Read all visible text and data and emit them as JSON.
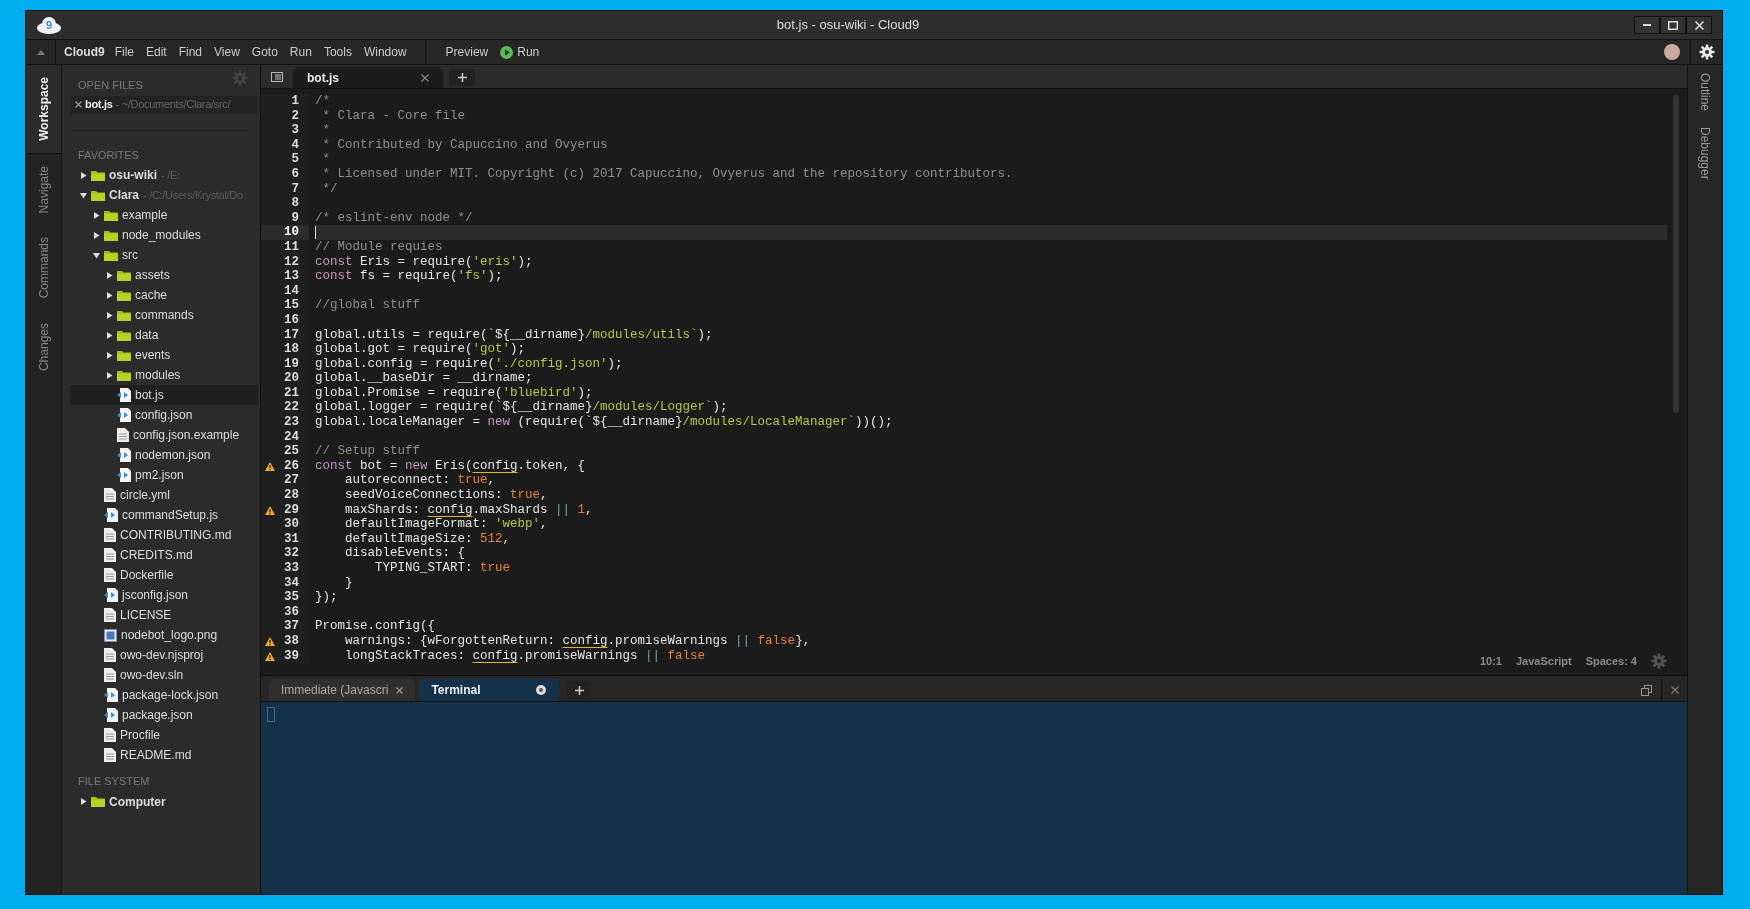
{
  "window": {
    "logo": "9",
    "title": "bot.js - osu-wiki - Cloud9"
  },
  "menu_bar": {
    "brand": "Cloud9",
    "items": [
      "File",
      "Edit",
      "Find",
      "View",
      "Goto",
      "Run",
      "Tools",
      "Window"
    ],
    "actions": [
      {
        "label": "Preview",
        "kind": "plain"
      },
      {
        "label": "Run",
        "kind": "run"
      }
    ]
  },
  "left_tabs": [
    {
      "label": "Workspace",
      "selected": true
    },
    {
      "label": "Navigate",
      "selected": false
    },
    {
      "label": "Commands",
      "selected": false
    },
    {
      "label": "Changes",
      "selected": false
    }
  ],
  "right_tabs": [
    {
      "label": "Outline",
      "selected": false
    },
    {
      "label": "Debugger",
      "selected": false
    }
  ],
  "sidebar": {
    "open_files_heading": "OPEN FILES",
    "open_files": [
      {
        "name": "bot.js",
        "path": "- ~/Documents/Clara/src/"
      }
    ],
    "favorites_heading": "FAVORITES",
    "favorites": [
      {
        "name": "osu-wiki",
        "path": "- /E:",
        "kind": "folder",
        "expanded": false,
        "selected": false
      },
      {
        "name": "Clara",
        "path": "- /C:/Users/Krystal/Do",
        "kind": "folder",
        "expanded": true,
        "selected": false,
        "children": [
          {
            "name": "example",
            "kind": "folder",
            "expanded": false,
            "selected": false
          },
          {
            "name": "node_modules",
            "kind": "folder",
            "expanded": false,
            "selected": false
          },
          {
            "name": "src",
            "kind": "folder",
            "expanded": true,
            "selected": false,
            "children": [
              {
                "name": "assets",
                "kind": "folder",
                "expanded": false,
                "selected": false
              },
              {
                "name": "cache",
                "kind": "folder",
                "expanded": false,
                "selected": false
              },
              {
                "name": "commands",
                "kind": "folder",
                "expanded": false,
                "selected": false
              },
              {
                "name": "data",
                "kind": "folder",
                "expanded": false,
                "selected": false
              },
              {
                "name": "events",
                "kind": "folder",
                "expanded": false,
                "selected": false
              },
              {
                "name": "modules",
                "kind": "folder",
                "expanded": false,
                "selected": false
              },
              {
                "name": "bot.js",
                "kind": "code",
                "selected": true
              },
              {
                "name": "config.json",
                "kind": "code",
                "selected": false
              },
              {
                "name": "config.json.example",
                "kind": "text",
                "selected": false
              },
              {
                "name": "nodemon.json",
                "kind": "code",
                "selected": false
              },
              {
                "name": "pm2.json",
                "kind": "code",
                "selected": false
              }
            ]
          },
          {
            "name": "circle.yml",
            "kind": "text",
            "selected": false
          },
          {
            "name": "commandSetup.js",
            "kind": "code",
            "selected": false
          },
          {
            "name": "CONTRIBUTING.md",
            "kind": "text",
            "selected": false
          },
          {
            "name": "CREDITS.md",
            "kind": "text",
            "selected": false
          },
          {
            "name": "Dockerfile",
            "kind": "text",
            "selected": false
          },
          {
            "name": "jsconfig.json",
            "kind": "code",
            "selected": false
          },
          {
            "name": "LICENSE",
            "kind": "text",
            "selected": false
          },
          {
            "name": "nodebot_logo.png",
            "kind": "image",
            "selected": false
          },
          {
            "name": "owo-dev.njsproj",
            "kind": "text",
            "selected": false
          },
          {
            "name": "owo-dev.sln",
            "kind": "text",
            "selected": false
          },
          {
            "name": "package-lock.json",
            "kind": "code",
            "selected": false
          },
          {
            "name": "package.json",
            "kind": "code",
            "selected": false
          },
          {
            "name": "Procfile",
            "kind": "text",
            "selected": false
          },
          {
            "name": "README.md",
            "kind": "text",
            "selected": false
          }
        ]
      }
    ],
    "file_system_heading": "FILE SYSTEM",
    "file_system": [
      {
        "name": "Computer",
        "kind": "folder",
        "expanded": false,
        "selected": false
      }
    ]
  },
  "editor": {
    "tabs": [
      {
        "label": "bot.js",
        "selected": true
      }
    ],
    "lines": [
      {
        "n": "1",
        "warning": false,
        "active": false,
        "tokens": [
          {
            "kind": "comment",
            "text": "/*"
          }
        ]
      },
      {
        "n": "2",
        "warning": false,
        "active": false,
        "tokens": [
          {
            "kind": "comment",
            "text": " * Clara - Core file"
          }
        ]
      },
      {
        "n": "3",
        "warning": false,
        "active": false,
        "tokens": [
          {
            "kind": "comment",
            "text": " *"
          }
        ]
      },
      {
        "n": "4",
        "warning": false,
        "active": false,
        "tokens": [
          {
            "kind": "comment",
            "text": " * Contributed by Capuccino and Ovyerus"
          }
        ]
      },
      {
        "n": "5",
        "warning": false,
        "active": false,
        "tokens": [
          {
            "kind": "comment",
            "text": " *"
          }
        ]
      },
      {
        "n": "6",
        "warning": false,
        "active": false,
        "tokens": [
          {
            "kind": "comment",
            "text": " * Licensed under MIT. Copyright (c) 2017 Capuccino, Ovyerus and the repository contributors."
          }
        ]
      },
      {
        "n": "7",
        "warning": false,
        "active": false,
        "tokens": [
          {
            "kind": "comment",
            "text": " */"
          }
        ]
      },
      {
        "n": "8",
        "warning": false,
        "active": false
      },
      {
        "n": "9",
        "warning": false,
        "active": false,
        "tokens": [
          {
            "kind": "comment",
            "text": "/* eslint-env node */"
          }
        ]
      },
      {
        "n": "10",
        "warning": false,
        "active": true
      },
      {
        "n": "11",
        "warning": false,
        "active": false,
        "tokens": [
          {
            "kind": "comment",
            "text": "// Module requies"
          }
        ]
      },
      {
        "n": "12",
        "warning": false,
        "active": false,
        "tokens": [
          {
            "kind": "keyword",
            "text": "const"
          },
          {
            "kind": "plain",
            "text": " Eris = require("
          },
          {
            "kind": "string",
            "text": "'eris'"
          },
          {
            "kind": "plain",
            "text": ");"
          }
        ]
      },
      {
        "n": "13",
        "warning": false,
        "active": false,
        "tokens": [
          {
            "kind": "keyword",
            "text": "const"
          },
          {
            "kind": "plain",
            "text": " fs = require("
          },
          {
            "kind": "string",
            "text": "'fs'"
          },
          {
            "kind": "plain",
            "text": ");"
          }
        ]
      },
      {
        "n": "14",
        "warning": false,
        "active": false
      },
      {
        "n": "15",
        "warning": false,
        "active": false,
        "tokens": [
          {
            "kind": "comment",
            "text": "//global stuff"
          }
        ]
      },
      {
        "n": "16",
        "warning": false,
        "active": false
      },
      {
        "n": "17",
        "warning": false,
        "active": false,
        "tokens": [
          {
            "kind": "plain",
            "text": "global.utils = require(`${__dirname}"
          },
          {
            "kind": "string",
            "text": "/modules/utils`"
          },
          {
            "kind": "plain",
            "text": ");"
          }
        ]
      },
      {
        "n": "18",
        "warning": false,
        "active": false,
        "tokens": [
          {
            "kind": "plain",
            "text": "global.got = require("
          },
          {
            "kind": "string",
            "text": "'got'"
          },
          {
            "kind": "plain",
            "text": ");"
          }
        ]
      },
      {
        "n": "19",
        "warning": false,
        "active": false,
        "tokens": [
          {
            "kind": "plain",
            "text": "global.config = require("
          },
          {
            "kind": "string",
            "text": "'./config.json'"
          },
          {
            "kind": "plain",
            "text": ");"
          }
        ]
      },
      {
        "n": "20",
        "warning": false,
        "active": false,
        "tokens": [
          {
            "kind": "plain",
            "text": "global.__baseDir = __dirname;"
          }
        ]
      },
      {
        "n": "21",
        "warning": false,
        "active": false,
        "tokens": [
          {
            "kind": "plain",
            "text": "global.Promise = require("
          },
          {
            "kind": "string",
            "text": "'bluebird'"
          },
          {
            "kind": "plain",
            "text": ");"
          }
        ]
      },
      {
        "n": "22",
        "warning": false,
        "active": false,
        "tokens": [
          {
            "kind": "plain",
            "text": "global.logger = require(`${__dirname}"
          },
          {
            "kind": "string",
            "text": "/modules/Logger`"
          },
          {
            "kind": "plain",
            "text": ");"
          }
        ]
      },
      {
        "n": "23",
        "warning": false,
        "active": false,
        "tokens": [
          {
            "kind": "plain",
            "text": "global.localeManager = "
          },
          {
            "kind": "keyword",
            "text": "new"
          },
          {
            "kind": "plain",
            "text": " (require(`${__dirname}"
          },
          {
            "kind": "string",
            "text": "/modules/LocaleManager`"
          },
          {
            "kind": "plain",
            "text": "))();"
          }
        ]
      },
      {
        "n": "24",
        "warning": false,
        "active": false
      },
      {
        "n": "25",
        "warning": false,
        "active": false,
        "tokens": [
          {
            "kind": "comment",
            "text": "// Setup stuff"
          }
        ]
      },
      {
        "n": "26",
        "warning": true,
        "active": false,
        "tokens": [
          {
            "kind": "keyword",
            "text": "const"
          },
          {
            "kind": "plain",
            "text": " bot = "
          },
          {
            "kind": "keyword",
            "text": "new"
          },
          {
            "kind": "plain",
            "text": " Eris("
          },
          {
            "kind": "flagged",
            "text": "config"
          },
          {
            "kind": "plain",
            "text": ".token, {"
          }
        ]
      },
      {
        "n": "27",
        "warning": false,
        "active": false,
        "tokens": [
          {
            "kind": "plain",
            "text": "    autoreconnect: "
          },
          {
            "kind": "literal",
            "text": "true"
          },
          {
            "kind": "plain",
            "text": ","
          }
        ]
      },
      {
        "n": "28",
        "warning": false,
        "active": false,
        "tokens": [
          {
            "kind": "plain",
            "text": "    seedVoiceConnections: "
          },
          {
            "kind": "literal",
            "text": "true"
          },
          {
            "kind": "plain",
            "text": ","
          }
        ]
      },
      {
        "n": "29",
        "warning": true,
        "active": false,
        "tokens": [
          {
            "kind": "plain",
            "text": "    maxShards: "
          },
          {
            "kind": "flagged",
            "text": "config"
          },
          {
            "kind": "plain",
            "text": ".maxShards "
          },
          {
            "kind": "operator",
            "text": "|| "
          },
          {
            "kind": "literal",
            "text": "1"
          },
          {
            "kind": "plain",
            "text": ","
          }
        ]
      },
      {
        "n": "30",
        "warning": false,
        "active": false,
        "tokens": [
          {
            "kind": "plain",
            "text": "    defaultImageFormat: "
          },
          {
            "kind": "string",
            "text": "'webp'"
          },
          {
            "kind": "plain",
            "text": ","
          }
        ]
      },
      {
        "n": "31",
        "warning": false,
        "active": false,
        "tokens": [
          {
            "kind": "plain",
            "text": "    defaultImageSize: "
          },
          {
            "kind": "literal",
            "text": "512"
          },
          {
            "kind": "plain",
            "text": ","
          }
        ]
      },
      {
        "n": "32",
        "warning": false,
        "active": false,
        "tokens": [
          {
            "kind": "plain",
            "text": "    disableEvents: {"
          }
        ]
      },
      {
        "n": "33",
        "warning": false,
        "active": false,
        "tokens": [
          {
            "kind": "plain",
            "text": "        TYPING_START: "
          },
          {
            "kind": "literal",
            "text": "true"
          }
        ]
      },
      {
        "n": "34",
        "warning": false,
        "active": false,
        "tokens": [
          {
            "kind": "plain",
            "text": "    }"
          }
        ]
      },
      {
        "n": "35",
        "warning": false,
        "active": false,
        "tokens": [
          {
            "kind": "plain",
            "text": "});"
          }
        ]
      },
      {
        "n": "36",
        "warning": false,
        "active": false
      },
      {
        "n": "37",
        "warning": false,
        "active": false,
        "tokens": [
          {
            "kind": "plain",
            "text": "Promise.config({"
          }
        ]
      },
      {
        "n": "38",
        "warning": true,
        "active": false,
        "tokens": [
          {
            "kind": "plain",
            "text": "    warnings: {wForgottenReturn: "
          },
          {
            "kind": "flagged",
            "text": "config"
          },
          {
            "kind": "plain",
            "text": ".promiseWarnings "
          },
          {
            "kind": "operator",
            "text": "|| "
          },
          {
            "kind": "literal",
            "text": "false"
          },
          {
            "kind": "plain",
            "text": "},"
          }
        ]
      },
      {
        "n": "39",
        "warning": true,
        "active": false,
        "tokens": [
          {
            "kind": "plain",
            "text": "    longStackTraces: "
          },
          {
            "kind": "flagged",
            "text": "config"
          },
          {
            "kind": "plain",
            "text": ".promiseWarnings "
          },
          {
            "kind": "operator",
            "text": "|| "
          },
          {
            "kind": "literal",
            "text": "false"
          }
        ]
      }
    ],
    "status": {
      "position": "10:1",
      "mode": "JavaScript",
      "indent": "Spaces: 4"
    }
  },
  "bottom_panel": {
    "tabs": [
      {
        "label": "Immediate (Javascri",
        "selected": false,
        "kind": "closable"
      },
      {
        "label": "Terminal",
        "selected": true,
        "kind": "busy"
      }
    ]
  }
}
